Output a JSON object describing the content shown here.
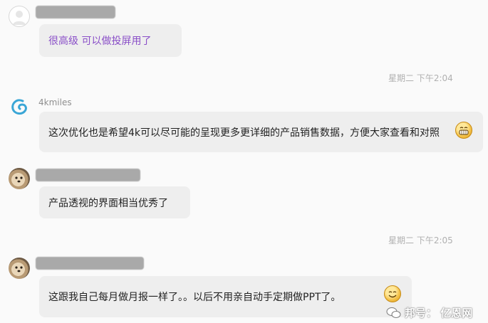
{
  "messages": [
    {
      "text": "很高级  可以做投屏用了"
    },
    {
      "time": "星期二  下午2:04",
      "sender": "4kmiles",
      "text": "这次优化也是希望4k可以尽可能的呈现更多更详细的产品销售数据，方便大家查看和对照",
      "emoji": "grin-emoji"
    },
    {
      "text": "产品透视的界面相当优秀了"
    },
    {
      "time": "星期二  下午2:05",
      "text": "这跟我自己每月做月报一样了。。以后不用亲自动手定期做PPT了。",
      "emoji": "smile-emoji"
    }
  ],
  "watermark": {
    "icon": "wechat-icon",
    "text": "邦号： 亿恩网"
  },
  "colors": {
    "first_message_text": "#8a4fc8",
    "bubble": "#eeeeee",
    "background": "#fafafa",
    "timestamp": "#b0b0b0"
  }
}
